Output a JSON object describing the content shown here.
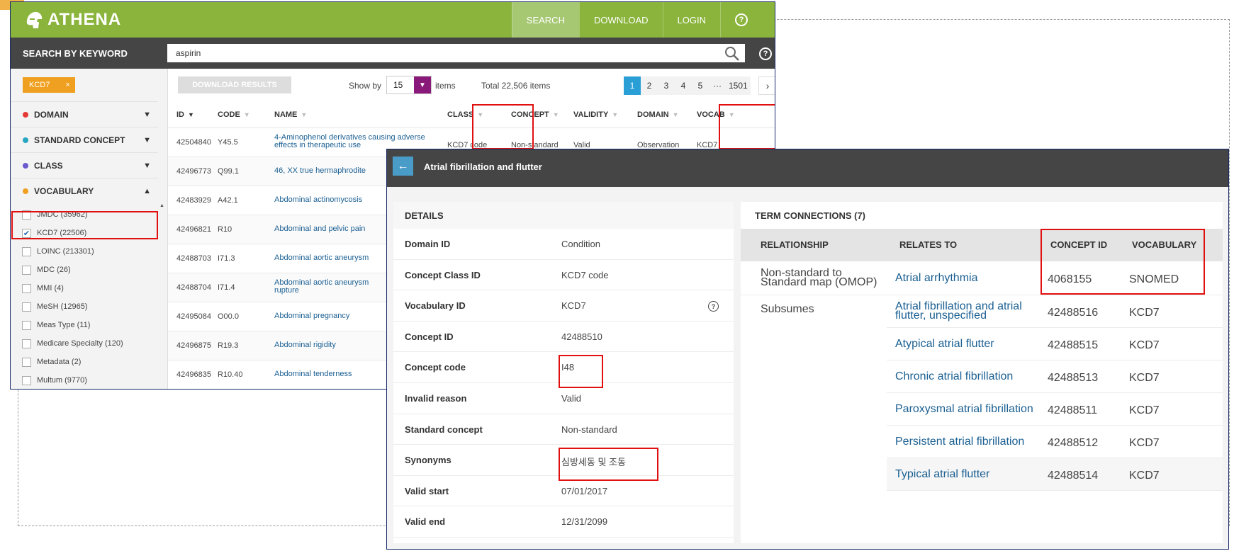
{
  "app": {
    "logo": "ATHENA",
    "nav": [
      {
        "label": "SEARCH"
      },
      {
        "label": "DOWNLOAD"
      },
      {
        "label": "LOGIN"
      }
    ]
  },
  "search": {
    "label": "SEARCH BY KEYWORD",
    "value": "aspirin"
  },
  "filters": {
    "chip": "KCD7",
    "facets": [
      {
        "label": "DOMAIN",
        "color": "#e53935"
      },
      {
        "label": "STANDARD CONCEPT",
        "color": "#26a6c1"
      },
      {
        "label": "CLASS",
        "color": "#6a5acd"
      },
      {
        "label": "VOCABULARY",
        "color": "#f0a020"
      }
    ],
    "vocabulary_items": [
      {
        "label": "JMDC (35962)",
        "checked": false
      },
      {
        "label": "KCD7 (22506)",
        "checked": true
      },
      {
        "label": "LOINC (213301)",
        "checked": false
      },
      {
        "label": "MDC (26)",
        "checked": false
      },
      {
        "label": "MMI (4)",
        "checked": false
      },
      {
        "label": "MeSH (12965)",
        "checked": false
      },
      {
        "label": "Meas Type (11)",
        "checked": false
      },
      {
        "label": "Medicare Specialty (120)",
        "checked": false
      },
      {
        "label": "Metadata (2)",
        "checked": false
      },
      {
        "label": "Multum (9770)",
        "checked": false
      }
    ]
  },
  "results": {
    "download_label": "DOWNLOAD RESULTS",
    "show_by_label": "Show by",
    "show_by_value": "15",
    "items_label": "items",
    "total": "Total 22,506 items",
    "pages": [
      "1",
      "2",
      "3",
      "4",
      "5",
      "···",
      "1501"
    ],
    "next": "›",
    "columns": [
      "ID",
      "CODE",
      "NAME",
      "CLASS",
      "CONCEPT",
      "VALIDITY",
      "DOMAIN",
      "VOCAB"
    ],
    "rows": [
      {
        "id": "42504840",
        "code": "Y45.5",
        "name": "4-Aminophenol derivatives causing adverse effects in therapeutic use",
        "class": "KCD7 code",
        "concept": "Non-standard",
        "validity": "Valid",
        "domain": "Observation",
        "vocab": "KCD7"
      },
      {
        "id": "42496773",
        "code": "Q99.1",
        "name": "46, XX true hermaphrodite"
      },
      {
        "id": "42483929",
        "code": "A42.1",
        "name": "Abdominal actinomycosis"
      },
      {
        "id": "42496821",
        "code": "R10",
        "name": "Abdominal and pelvic pain"
      },
      {
        "id": "42488703",
        "code": "I71.3",
        "name": "Abdominal aortic aneurysm"
      },
      {
        "id": "42488704",
        "code": "I71.4",
        "name": "Abdominal aortic aneurysm rupture"
      },
      {
        "id": "42495084",
        "code": "O00.0",
        "name": "Abdominal pregnancy"
      },
      {
        "id": "42496875",
        "code": "R19.3",
        "name": "Abdominal rigidity"
      },
      {
        "id": "42496835",
        "code": "R10.40",
        "name": "Abdominal tenderness"
      }
    ]
  },
  "concept": {
    "title": "Atrial fibrillation and flutter",
    "details_heading": "DETAILS",
    "details": [
      {
        "key": "Domain ID",
        "value": "Condition"
      },
      {
        "key": "Concept Class ID",
        "value": "KCD7 code"
      },
      {
        "key": "Vocabulary ID",
        "value": "KCD7"
      },
      {
        "key": "Concept ID",
        "value": "42488510"
      },
      {
        "key": "Concept code",
        "value": "I48"
      },
      {
        "key": "Invalid reason",
        "value": "Valid"
      },
      {
        "key": "Standard concept",
        "value": "Non-standard"
      },
      {
        "key": "Synonyms",
        "value": "심방세동 및 조동"
      },
      {
        "key": "Valid start",
        "value": "07/01/2017"
      },
      {
        "key": "Valid end",
        "value": "12/31/2099"
      }
    ],
    "terms_heading": "TERM CONNECTIONS (7)",
    "terms_columns": [
      "RELATIONSHIP",
      "RELATES TO",
      "CONCEPT ID",
      "VOCABULARY"
    ],
    "relationships": [
      {
        "name": "Non-standard to Standard map (OMOP)",
        "items": [
          {
            "relates_to": "Atrial arrhythmia",
            "concept_id": "4068155",
            "vocabulary": "SNOMED"
          }
        ]
      },
      {
        "name": "Subsumes",
        "items": [
          {
            "relates_to": "Atrial fibrillation and atrial flutter, unspecified",
            "concept_id": "42488516",
            "vocabulary": "KCD7"
          },
          {
            "relates_to": "Atypical atrial flutter",
            "concept_id": "42488515",
            "vocabulary": "KCD7"
          },
          {
            "relates_to": "Chronic atrial fibrillation",
            "concept_id": "42488513",
            "vocabulary": "KCD7"
          },
          {
            "relates_to": "Paroxysmal atrial fibrillation",
            "concept_id": "42488511",
            "vocabulary": "KCD7"
          },
          {
            "relates_to": "Persistent atrial fibrillation",
            "concept_id": "42488512",
            "vocabulary": "KCD7"
          },
          {
            "relates_to": "Typical atrial flutter",
            "concept_id": "42488514",
            "vocabulary": "KCD7"
          }
        ]
      }
    ]
  },
  "colors": {
    "brand_green": "#8ab43c",
    "header_dark": "#454545",
    "highlight_red": "#e01010",
    "link_blue": "#1a5f92",
    "chip_orange": "#f0a020",
    "pager_active": "#2a9fd6"
  }
}
